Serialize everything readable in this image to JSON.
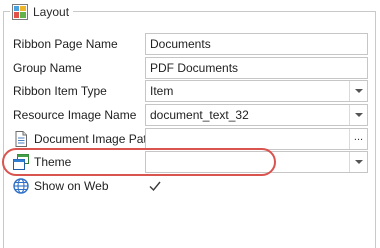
{
  "group": {
    "title": "Layout",
    "icon": "layout-group-icon"
  },
  "rows": [
    {
      "label": "Ribbon Page Name",
      "value": "Documents",
      "control": "text"
    },
    {
      "label": "Group Name",
      "value": "PDF Documents",
      "control": "text"
    },
    {
      "label": "Ribbon Item Type",
      "value": "Item",
      "control": "dropdown"
    },
    {
      "label": "Resource Image Name",
      "value": "document_text_32",
      "control": "dropdown"
    },
    {
      "label": "Document Image Path",
      "value": "",
      "control": "browse",
      "icon": "document-icon",
      "button_label": "..."
    },
    {
      "label": "Theme",
      "value": "",
      "control": "dropdown",
      "icon": "theme-icon"
    },
    {
      "label": "Show on Web",
      "checked": true,
      "control": "checkbox",
      "icon": "globe-icon"
    }
  ],
  "highlight_color": "#d9534f"
}
